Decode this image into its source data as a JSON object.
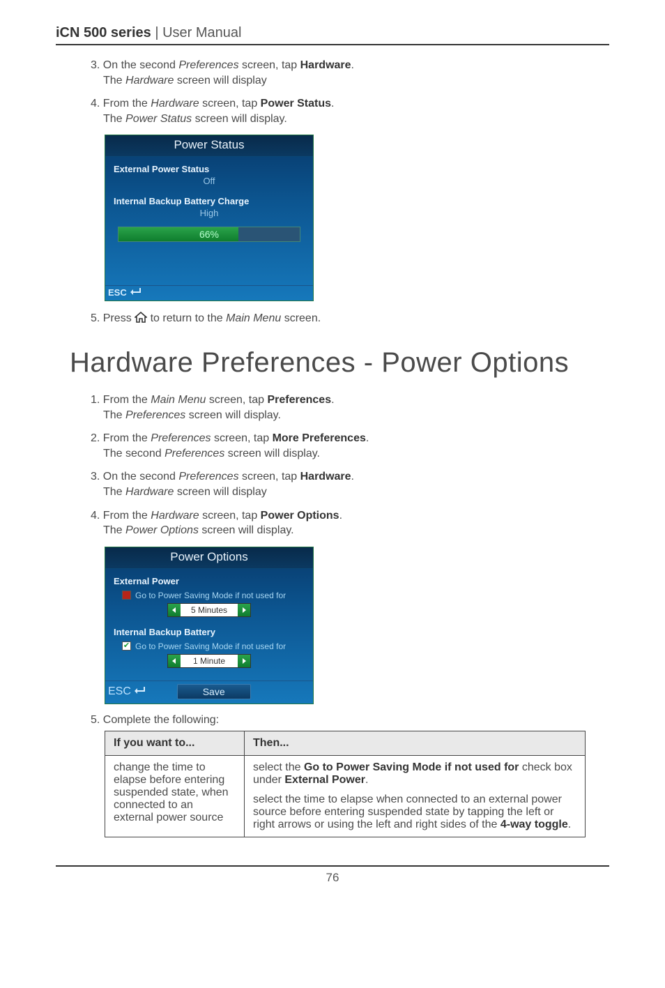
{
  "header": {
    "product": "iCN 500 series",
    "sep": " | ",
    "doc": "User Manual"
  },
  "steps_a": {
    "s3_num": "3. ",
    "s3_a_pre": "On the second ",
    "s3_a_ital": "Preferences",
    "s3_a_mid": " screen, tap ",
    "s3_a_bold": "Hardware",
    "s3_a_post": ".",
    "s3_b_pre": "The ",
    "s3_b_ital": "Hardware",
    "s3_b_post": " screen will display",
    "s4_num": "4. ",
    "s4_a_pre": "From the ",
    "s4_a_ital": "Hardware",
    "s4_a_mid": " screen, tap ",
    "s4_a_bold": "Power Status",
    "s4_a_post": ".",
    "s4_b_pre": "The ",
    "s4_b_ital": "Power Status",
    "s4_b_post": " screen will display.",
    "s5_num": "5. ",
    "s5_a_pre": "Press ",
    "s5_a_mid": " to return to the ",
    "s5_a_ital": "Main Menu",
    "s5_a_post": " screen."
  },
  "device1": {
    "title": "Power Status",
    "row1_label": "External Power Status",
    "row1_val": "Off",
    "row2_label": "Internal Backup Battery Charge",
    "row2_val": "High",
    "progress": "66%",
    "esc": "ESC"
  },
  "section_title": "Hardware Preferences - Power Options",
  "steps_b": {
    "s1_num": "1. ",
    "s1_a_pre": "From the ",
    "s1_a_ital": "Main Menu",
    "s1_a_mid": " screen, tap ",
    "s1_a_bold": "Preferences",
    "s1_a_post": ".",
    "s1_b_pre": "The ",
    "s1_b_ital": "Preferences",
    "s1_b_post": " screen will display.",
    "s2_num": "2. ",
    "s2_a_pre": "From the ",
    "s2_a_ital": "Preferences",
    "s2_a_mid": " screen, tap ",
    "s2_a_bold": "More Preferences",
    "s2_a_post": ".",
    "s2_b_pre": "The second ",
    "s2_b_ital": "Preferences",
    "s2_b_post": " screen will display.",
    "s3_num": "3. ",
    "s3_a_pre": "On the second ",
    "s3_a_ital": "Preferences",
    "s3_a_mid": " screen, tap ",
    "s3_a_bold": "Hardware",
    "s3_a_post": ".",
    "s3_b_pre": "The ",
    "s3_b_ital": "Hardware",
    "s3_b_post": " screen will display",
    "s4_num": "4. ",
    "s4_a_pre": "From the ",
    "s4_a_ital": "Hardware",
    "s4_a_mid": " screen, tap ",
    "s4_a_bold": "Power Options",
    "s4_a_post": ".",
    "s4_b_pre": "The ",
    "s4_b_ital": "Power Options",
    "s4_b_post": " screen will display.",
    "s5_num": "5. ",
    "s5_text": "Complete the following:"
  },
  "device2": {
    "title": "Power Options",
    "ext_label": "External Power",
    "ext_chk_text": "Go to Power Saving Mode if not used for",
    "ext_spin": "5 Minutes",
    "int_label": "Internal Backup Battery",
    "int_chk_text": "Go to Power Saving Mode if not used for",
    "int_spin": "1 Minute",
    "esc": "ESC",
    "save": "Save"
  },
  "table": {
    "h1": "If you want to...",
    "h2": "Then...",
    "r1c1": "change the time to elapse before entering suspended state, when connected to an external power source",
    "r1c2_a_pre": "select the ",
    "r1c2_a_bold": "Go to Power Saving Mode if not used for",
    "r1c2_a_mid": " check box under ",
    "r1c2_a_bold2": "External Power",
    "r1c2_a_post": ".",
    "r1c2_b_pre": "select the time to elapse when connected to an external power source before entering suspended state by tapping the left or right arrows or using the left and right sides of the ",
    "r1c2_b_bold": "4-way toggle",
    "r1c2_b_post": "."
  },
  "page_number": "76"
}
